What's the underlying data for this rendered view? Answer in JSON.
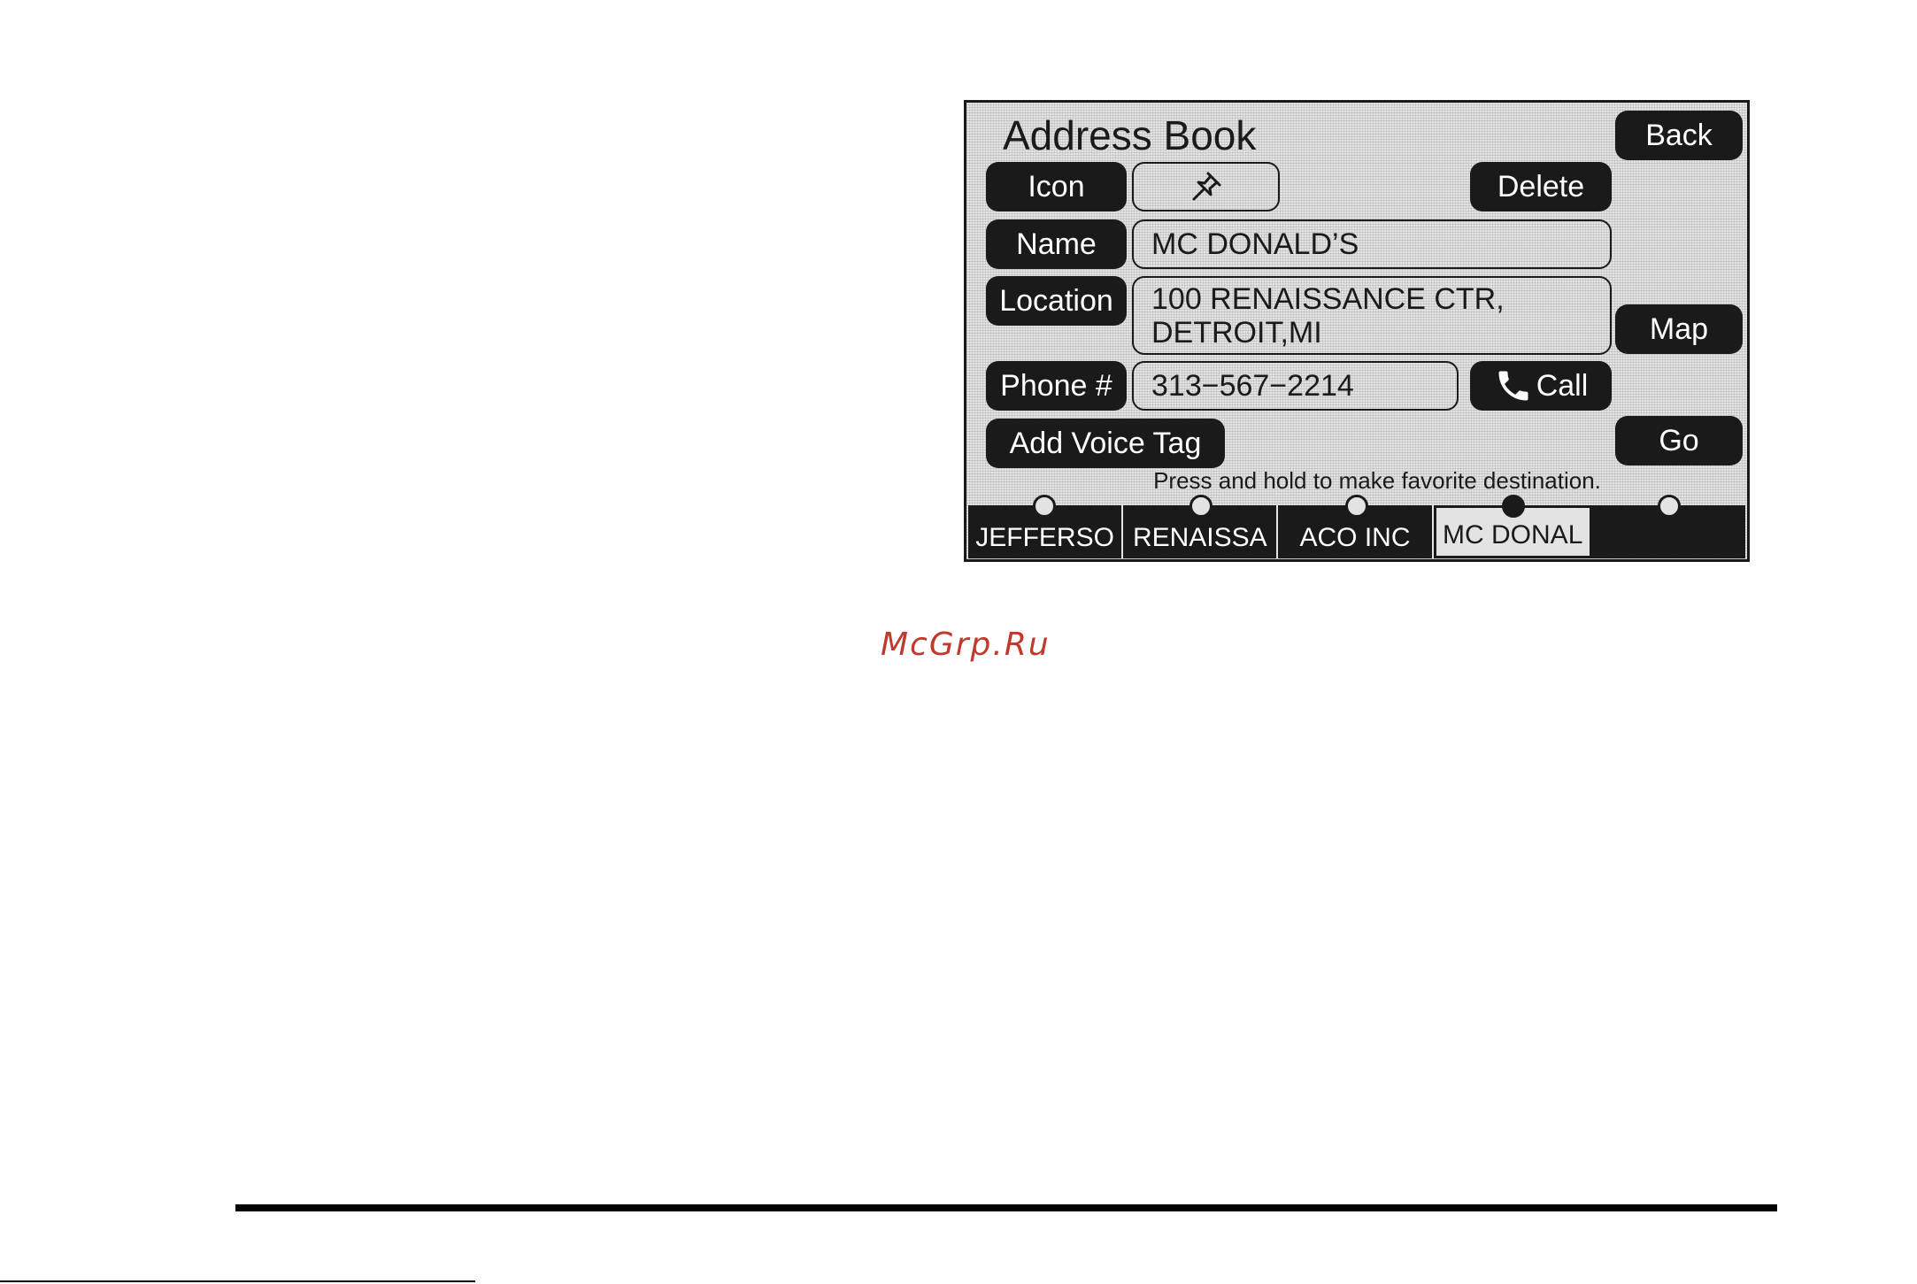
{
  "screen": {
    "title": "Address Book",
    "buttons": {
      "back": "Back",
      "icon": "Icon",
      "delete": "Delete",
      "name": "Name",
      "location": "Location",
      "map": "Map",
      "phone": "Phone #",
      "call": "Call",
      "add_voice_tag": "Add Voice Tag",
      "go": "Go"
    },
    "fields": {
      "icon_value": "pushpin-icon",
      "name_value": "MC DONALD’S",
      "location_line1": "100 RENAISSANCE CTR,",
      "location_line2": "DETROIT,MI",
      "phone_value": "313−567−2214"
    },
    "hint": "Press and hold to make favorite destination.",
    "presets": [
      {
        "label": "JEFFERSO",
        "selected": false,
        "dot_filled": false
      },
      {
        "label": "RENAISSA",
        "selected": false,
        "dot_filled": false
      },
      {
        "label": "ACO INC",
        "selected": false,
        "dot_filled": false
      },
      {
        "label": "MC DONAL",
        "selected": true,
        "dot_filled": true
      },
      {
        "label": "",
        "selected": false,
        "dot_filled": false
      }
    ]
  },
  "watermark": "McGrp.Ru",
  "colors": {
    "screen_bg": "#e3e3e3",
    "button_bg": "#1a1a1a",
    "button_text": "#ffffff",
    "watermark": "#c0392b"
  }
}
